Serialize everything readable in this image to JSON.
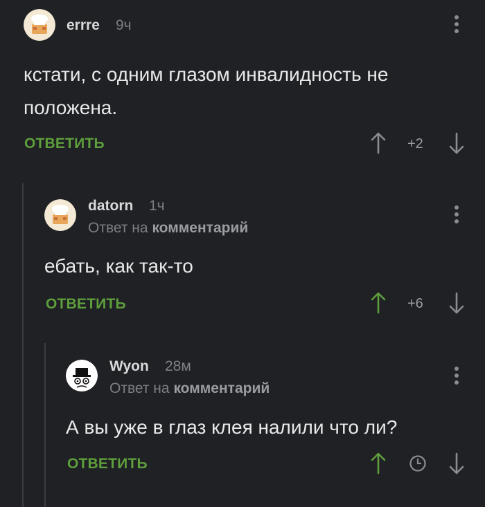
{
  "comments": [
    {
      "username": "errre",
      "time": "9ч",
      "text": "кстати, с одним глазом инвалидность не положена.",
      "reply_label": "ОТВЕТИТЬ",
      "score": "+2",
      "upvoted": false
    },
    {
      "username": "datorn",
      "time": "1ч",
      "reply_prefix": "Ответ на",
      "reply_target": "комментарий",
      "text": "ебать, как так-то",
      "reply_label": "ОТВЕТИТЬ",
      "score": "+6",
      "upvoted": true
    },
    {
      "username": "Wyon",
      "time": "28м",
      "reply_prefix": "Ответ на",
      "reply_target": "комментарий",
      "text": "А вы уже в глаз клея налили что ли?",
      "reply_label": "ОТВЕТИТЬ",
      "score_hidden_icon": "clock-icon",
      "upvoted": true
    }
  ],
  "colors": {
    "background": "#1f2124",
    "accent_green": "#5e9e3c",
    "muted_text": "#7d7f83",
    "thread_line": "#3a3c40"
  }
}
